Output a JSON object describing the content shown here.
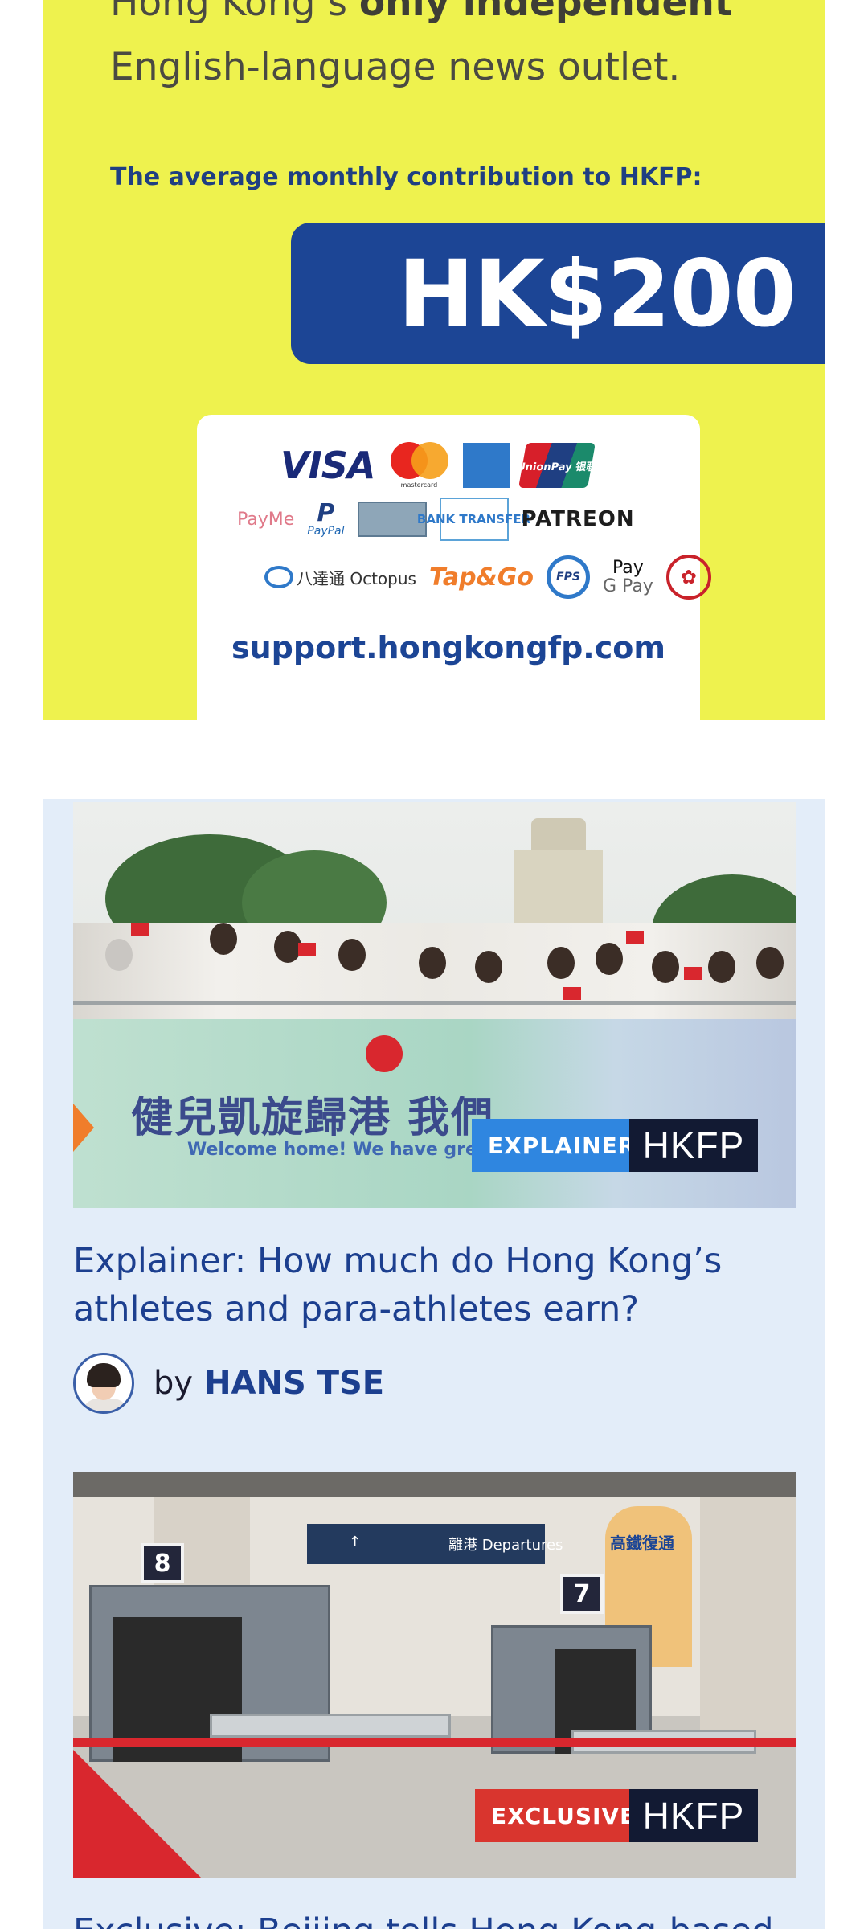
{
  "banner": {
    "line1_prefix": "Hong Kong’s ",
    "line1_bold": "only independent",
    "line2": "English-language news outlet.",
    "avg_label": "The average monthly contribution to HKFP:",
    "amount": "HK$200",
    "logos": {
      "visa": "VISA",
      "mastercard": "mastercard",
      "unionpay": "UnionPay 银联",
      "payme": "PayMe",
      "paypal_mark": "P",
      "paypal": "PayPal",
      "bank_transfer": "BANK TRANSFER",
      "patreon": "PATREON",
      "octopus": "八達通 Octopus",
      "tapgo": "Tap&Go",
      "fps": "FPS",
      "apple_pay": "Pay",
      "google_pay": "G Pay"
    },
    "support_url": "support.hongkongfp.com",
    "colors": {
      "background": "#eef24e",
      "brand_blue": "#1c4595"
    }
  },
  "articles": [
    {
      "tag": "EXPLAINER",
      "brand": "HKFP",
      "image_banner_cn": "健兒凱旋歸港 我們",
      "image_banner_en": "Welcome home! We have great pride in you!!",
      "title": "Explainer: How much do Hong Kong’s athletes and para-athletes earn?",
      "by": "by",
      "author": "HANS TSE"
    },
    {
      "tag": "EXCLUSIVE",
      "brand": "HKFP",
      "image_sign": "離港 Departures",
      "gate_left": "8",
      "gate_right": "7",
      "standee_text": "高鐵復通",
      "title": "Exclusive: Beijing tells Hong Kong-based"
    }
  ],
  "colors": {
    "list_background": "#e3edf9",
    "title_color": "#1c3f8f",
    "tag_explainer": "#2f86e0",
    "tag_exclusive": "#d9352e",
    "hkfp_badge": "#121a33"
  }
}
